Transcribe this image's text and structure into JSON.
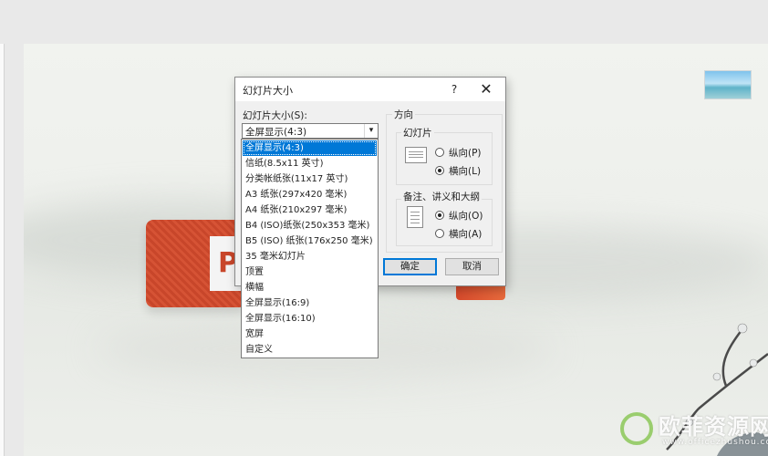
{
  "dialog": {
    "title": "幻灯片大小",
    "help_label": "?",
    "close_label": "✕",
    "size_label": "幻灯片大小(S):",
    "size_selected": "全屏显示(4:3)",
    "dropdown_arrow": "▾",
    "orientation_label": "方向",
    "slides_group": {
      "label": "幻灯片",
      "portrait_label": "纵向(P)",
      "landscape_label": "横向(L)",
      "selected": "landscape"
    },
    "notes_group": {
      "label": "备注、讲义和大纲",
      "portrait_label": "纵向(O)",
      "landscape_label": "横向(A)",
      "selected": "portrait"
    },
    "ok_label": "确定",
    "cancel_label": "取消"
  },
  "dropdown": {
    "options": [
      "全屏显示(4:3)",
      "信纸(8.5x11 英寸)",
      "分类帐纸张(11x17 英寸)",
      "A3 纸张(297x420 毫米)",
      "A4 纸张(210x297 毫米)",
      "B4 (ISO)纸张(250x353 毫米)",
      "B5 (ISO) 纸张(176x250 毫米)",
      "35 毫米幻灯片",
      "顶置",
      "横幅",
      "全屏显示(16:9)",
      "全屏显示(16:10)",
      "宽屏",
      "自定义"
    ],
    "selected_index": 0
  },
  "slide": {
    "logo_letter": "P"
  },
  "watermark": {
    "name": "欧菲资源网",
    "url": "www.officezhushou.com"
  },
  "colors": {
    "accent": "#0078d7",
    "ppt_red": "#c8462a"
  }
}
